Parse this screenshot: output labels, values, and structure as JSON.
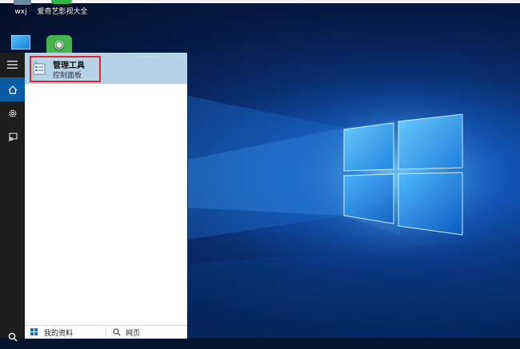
{
  "desktop": {
    "icons": [
      {
        "label": "wxj",
        "icon": "user-folder-icon"
      },
      {
        "label": "爱奇艺影视大全",
        "icon": "iqiyi-app-icon"
      },
      {
        "label": "",
        "icon": "this-pc-icon"
      },
      {
        "label": "",
        "icon": "video-player-icon"
      }
    ]
  },
  "start_menu": {
    "rail": {
      "menu_icon": "≡",
      "home_icon": "⌂",
      "settings_icon": "⚙",
      "feedback_icon": "feedback-icon",
      "search_icon": "search-icon"
    },
    "result": {
      "title": "管理工具",
      "subtitle": "控制面板",
      "icon": "admin-tools-icon"
    },
    "tabs": {
      "mystuff": "我的资料",
      "web": "网页"
    }
  },
  "colors": {
    "rail_bg": "#1d1d1d",
    "rail_active": "#0a5ba6",
    "result_highlight": "#b7d3e8",
    "annotation_red": "#e0262d"
  }
}
